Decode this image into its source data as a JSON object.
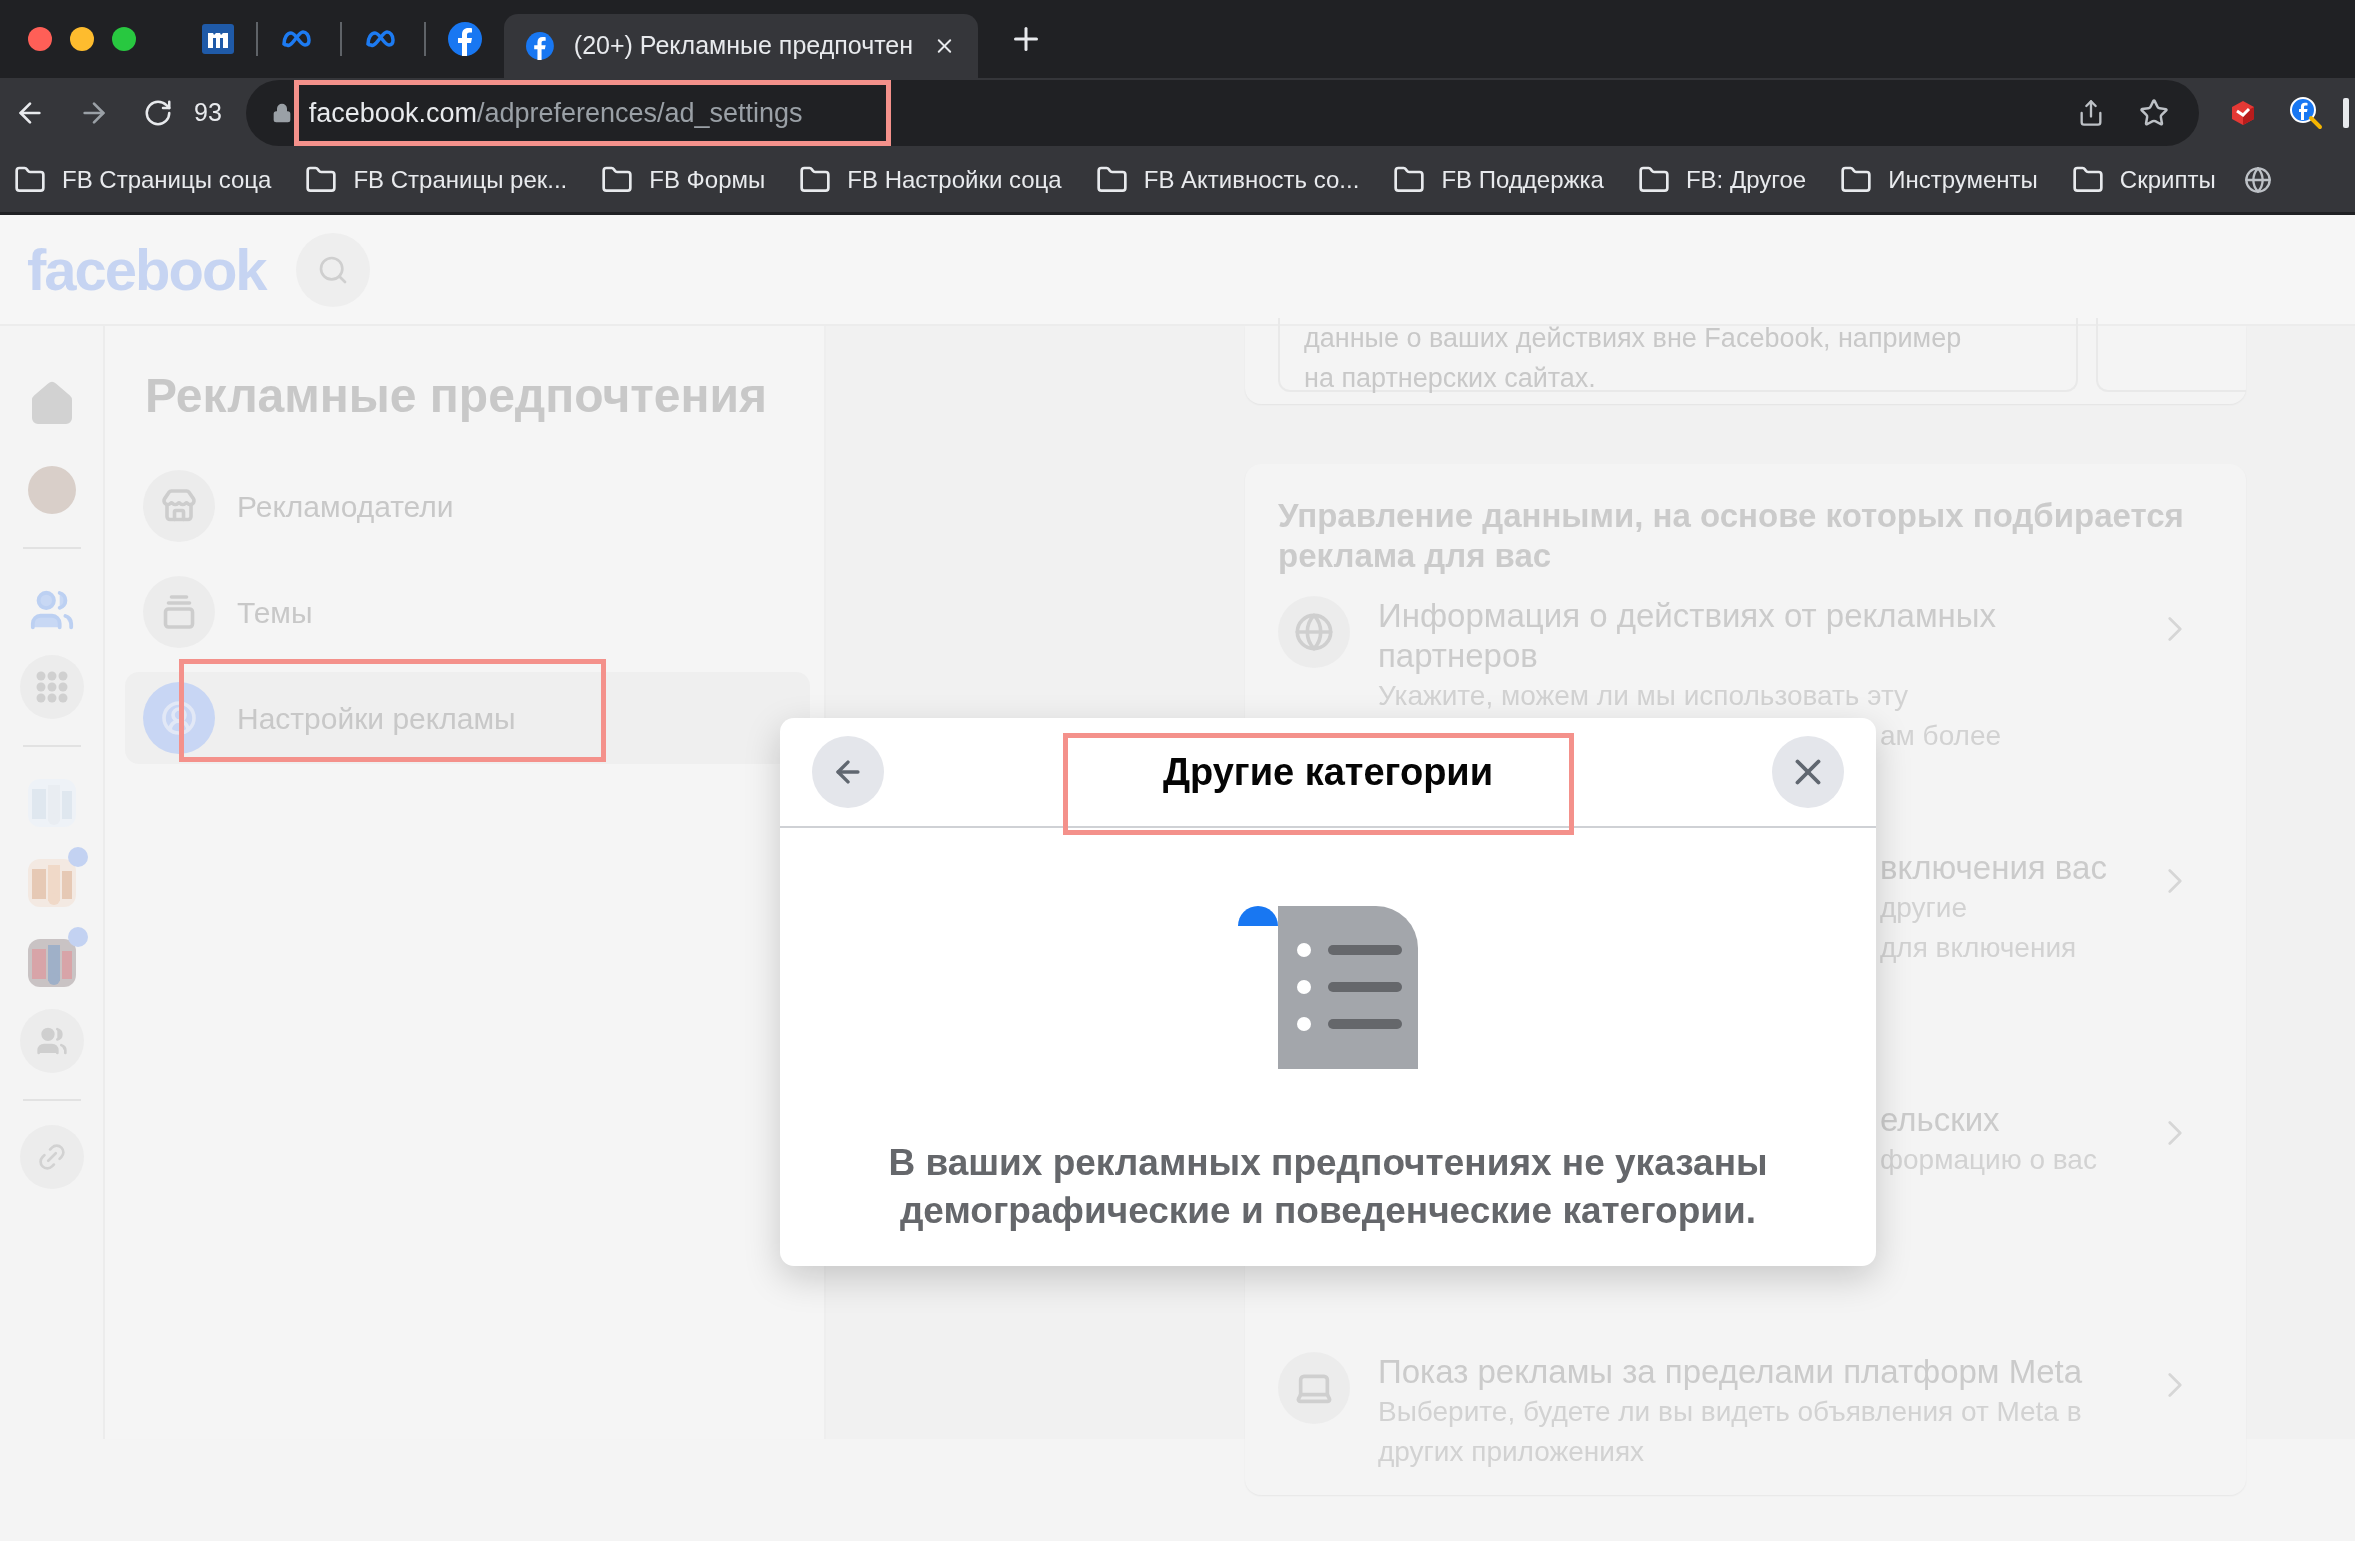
{
  "browser": {
    "active_tab": {
      "title": "(20+) Рекламные предпочтен",
      "selected": true
    },
    "reload_badge": "93",
    "address": {
      "domain": "facebook.com",
      "path": "/adpreferences/ad_settings"
    },
    "bookmarks": [
      "FB Страницы соца",
      "FB Страницы рек...",
      "FB Формы",
      "FB Настройки соца",
      "FB Активность со...",
      "FB Поддержка",
      "FB: Другое",
      "Инструменты",
      "Скрипты"
    ]
  },
  "header": {
    "logo": "facebook"
  },
  "sidebar": {
    "title": "Рекламные предпочтения",
    "items": [
      {
        "label": "Рекламодатели",
        "kind": "store",
        "selected": false
      },
      {
        "label": "Темы",
        "kind": "topics",
        "selected": false
      },
      {
        "label": "Настройки рекламы",
        "kind": "settings",
        "selected": true
      }
    ]
  },
  "content": {
    "top_card_lines": [
      "данные о ваших действиях вне Facebook, например",
      "на партнерских сайтах."
    ],
    "section": {
      "title": "Управление данными, на основе которых подбирается реклама для вас",
      "rows": [
        {
          "kind": "globe",
          "title": "Информация о действиях от рекламных партнеров",
          "lines": [
            "Укажите, можем ли мы использовать эту"
          ],
          "visible_tail": "ам более"
        },
        {
          "kind": "covered",
          "title": "включения вас",
          "lines": [
            "другие",
            "для включения"
          ]
        },
        {
          "kind": "covered",
          "title": "ельских",
          "lines": [
            "формацию о вас"
          ]
        },
        {
          "kind": "laptop",
          "title": "Показ рекламы за пределами платформ Meta",
          "lines": [
            "Выберите, будете ли вы видеть объявления от Meta в",
            "других приложениях"
          ]
        }
      ]
    }
  },
  "modal": {
    "title": "Другие категории",
    "message": "В ваших рекламных предпочтениях не указаны демографические и поведенческие категории."
  }
}
